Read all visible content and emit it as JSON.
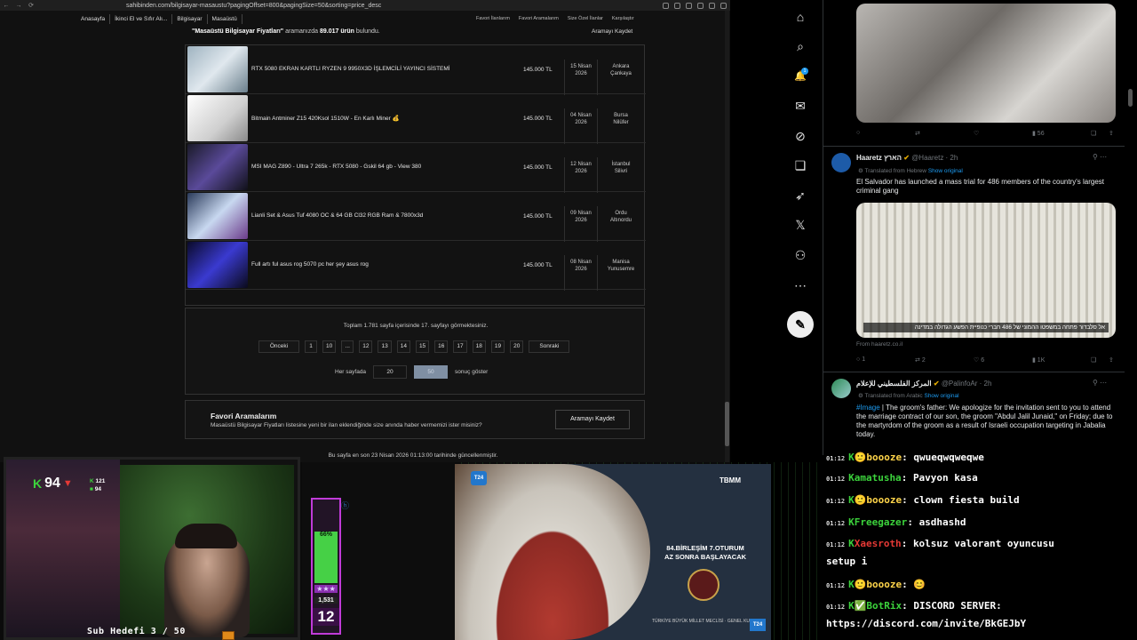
{
  "browser": {
    "url": "sahibinden.com/bilgisayar-masaustu?pagingOffset=800&pagingSize=50&sorting=price_desc"
  },
  "site": {
    "breadcrumbs": [
      "Anasayfa",
      "İkinci El ve Sıfır Alı...",
      "Bilgisayar",
      "Masaüstü"
    ],
    "top_links": [
      "Favori İlanlarım",
      "Favori Aramalarım",
      "Size Özel İlanlar",
      "Karşılaştır"
    ],
    "save_search": "Aramayı Kaydet",
    "results_query": "\"Masaüstü Bilgisayar Fiyatları\"",
    "results_mid": " aramanızda ",
    "results_count": "89.017 ürün",
    "results_end": " bulundu.",
    "listings": [
      {
        "title": "RTX 5080 EKRAN KARTLI RYZEN 9 9950X3D İŞLEMCİLİ YAYINCI SİSTEMİ",
        "price": "145.000 TL",
        "date1": "15 Nisan",
        "date2": "2026",
        "city": "Ankara",
        "district": "Çankaya",
        "thumb": "#9fb3c0"
      },
      {
        "title": "Bitmain Antminer Z15 420Ksol 1510W - En Karlı Miner 💰",
        "price": "145.000 TL",
        "date1": "04 Nisan",
        "date2": "2026",
        "city": "Bursa",
        "district": "Nilüfer",
        "thumb": "#e8e8e8"
      },
      {
        "title": "MSI MAG Z890 - Ultra 7 265k - RTX 5080 - Gskil 64 gb - View 380",
        "price": "145.000 TL",
        "date1": "12 Nisan",
        "date2": "2026",
        "city": "İstanbul",
        "district": "Silivri",
        "thumb": "#2a2a3a"
      },
      {
        "title": "Lianli Set & Asus Tuf 4080 OC & 64 GB Cl32 RGB Ram & 7800x3d",
        "price": "145.000 TL",
        "date1": "09 Nisan",
        "date2": "2026",
        "city": "Ordu",
        "district": "Altınordu",
        "thumb": "#3a4a6a"
      },
      {
        "title": "Full artı ful asus rog 5070 pc her şey asus rog",
        "price": "145.000 TL",
        "date1": "08 Nisan",
        "date2": "2026",
        "city": "Manisa",
        "district": "Yunusemre",
        "thumb": "#22224a"
      }
    ],
    "pager_info": "Toplam 1.781 sayfa içerisinde 17. sayfayı görmektesiniz.",
    "prev": "Önceki",
    "next": "Sonraki",
    "pages": [
      "1",
      "10",
      "...",
      "12",
      "13",
      "14",
      "15",
      "16",
      "17",
      "18",
      "19",
      "20"
    ],
    "per_page_label": "Her sayfada",
    "per_page_opts": [
      "20",
      "50"
    ],
    "per_page_suffix": "sonuç göster",
    "fav_title": "Favori Aramalarım",
    "fav_sub": "Masaüstü Bilgisayar Fiyatları listesine yeni bir ilan eklendiğinde size anında haber vermemizi ister misiniz?",
    "fav_button": "Aramayı Kaydet",
    "updated": "Bu sayfa en son 23 Nisan 2026 01:13:00 tarihinde güncellenmiştir."
  },
  "twitter": {
    "nav_icons": [
      "⌂",
      "⌕",
      "🔔",
      "✉",
      "⊘",
      "❏",
      "➶",
      "𝕏",
      "⚇",
      "⋯"
    ],
    "badge": "1",
    "post": "✎",
    "tweet1_actions": [
      "",
      "",
      "",
      "56",
      "",
      ""
    ],
    "t2": {
      "name": "Haaretz הארץ",
      "handle": "@Haaretz · 2h",
      "translated": "Translated from Hebrew",
      "show": "Show original",
      "text": "El Salvador has launched a mass trial for 486 members of the country's largest criminal gang",
      "caption": "אל סלבדור פתחה במשפטו ההמוני של 486 חברי כנופיית הפשע הגדולה במדינה",
      "from": "From haaretz.co.il",
      "actions": [
        "1",
        "2",
        "",
        "6",
        "1K",
        ""
      ]
    },
    "t3": {
      "name": "المركز الفلسطيني للإعلام",
      "handle": "@PalinfoAr · 2h",
      "translated": "Translated from Arabic",
      "show": "Show original",
      "tag": "#Image",
      "text": " | The groom's father: We apologize for the invitation sent to you to attend the marriage contract of our son, the groom \"Abdul Jalil Junaid,\" on Friday; due to the martyrdom of the groom as a result of Israeli occupation targeting in Jabalia today."
    }
  },
  "stream": {
    "kick_score": "94",
    "kick_small": [
      "121",
      "94"
    ],
    "sub_goal": "Sub Hedefi 3 / 50",
    "meter_pct": "66%",
    "meter_stars": "★★★",
    "meter_num1": "1,531",
    "meter_num2": "12",
    "tv_channel": "T24",
    "tv_tbmm": "TBMM",
    "tv_line1": "84.BİRLEŞİM  7.OTURUM",
    "tv_line2": "AZ SONRA BAŞLAYACAK",
    "tv_footer": "TÜRKİYE BÜYÜK MİLLET MECLİSİ · GENEL KURUL"
  },
  "chat": [
    {
      "ts": "01:12",
      "user": "boooze",
      "color": "u2",
      "msg": "qwueqwqweqwe"
    },
    {
      "ts": "01:12",
      "user": "amatusha",
      "color": "u1",
      "msg": "Pavyon kasa"
    },
    {
      "ts": "01:12",
      "user": "boooze",
      "color": "u2",
      "msg": "clown fiesta build"
    },
    {
      "ts": "01:12",
      "user": "Freegazer",
      "color": "u1",
      "msg": "asdhashd"
    },
    {
      "ts": "01:12",
      "user": "Xaesroth",
      "color": "u3",
      "msg": "kolsuz valorant oyuncusu"
    },
    {
      "ts": "",
      "user": "",
      "color": "u1",
      "msg": "setup i"
    },
    {
      "ts": "01:12",
      "user": "boooze",
      "color": "u2",
      "msg": "😊"
    },
    {
      "ts": "01:12",
      "user": "BotRix",
      "color": "u1",
      "msg": "DISCORD SERVER:"
    },
    {
      "ts": "",
      "user": "",
      "color": "u1",
      "msg": "https://discord.com/invite/BkGEJbY"
    }
  ]
}
